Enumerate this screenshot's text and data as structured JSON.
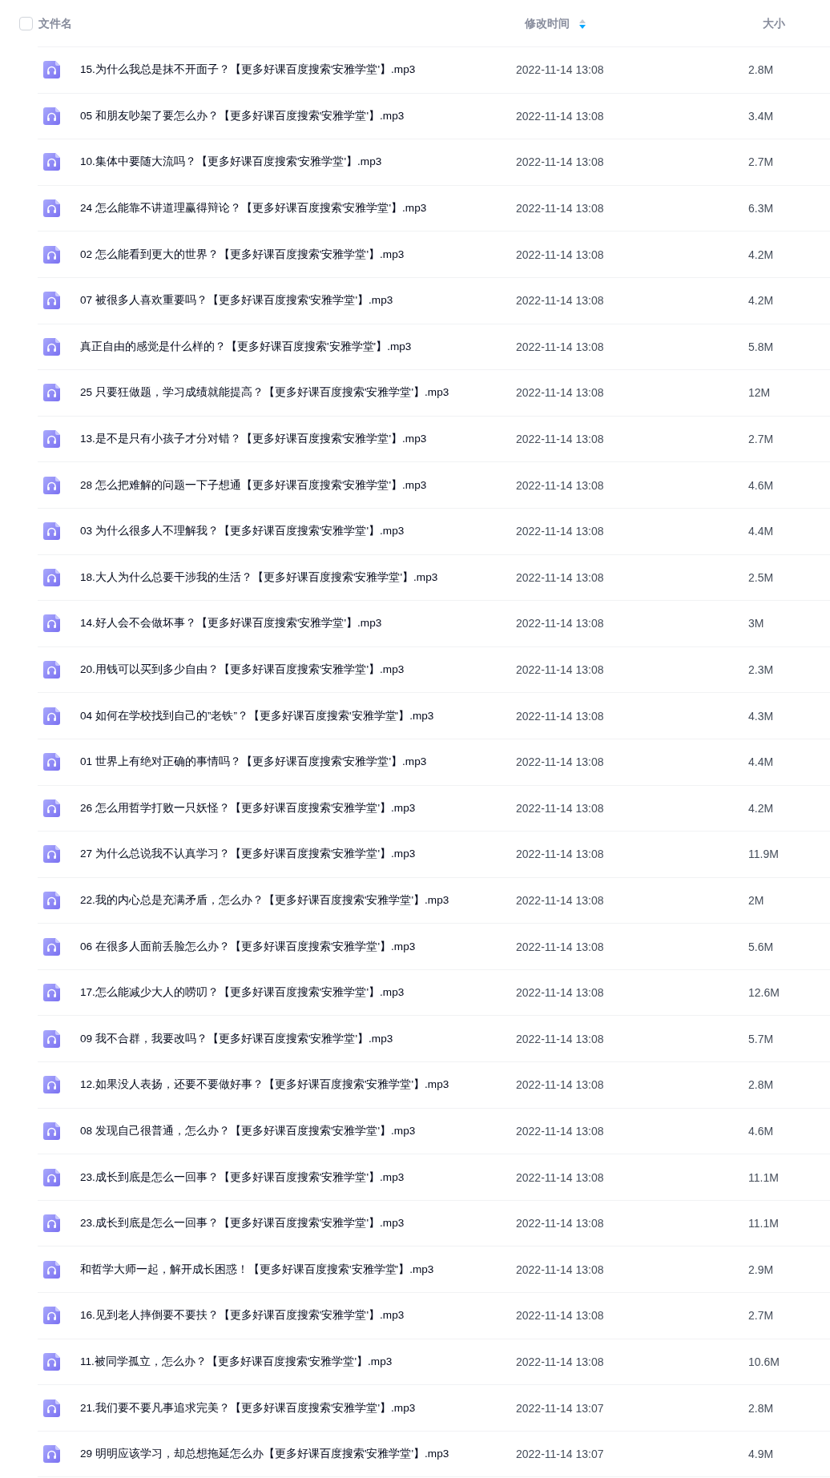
{
  "header": {
    "select_all": {
      "checked": false
    },
    "columns": [
      {
        "label": "文件名"
      },
      {
        "label": "修改时间",
        "sort_descending": true
      },
      {
        "label": "大小"
      }
    ]
  },
  "files": [
    {
      "name": "15.为什么我总是抹不开面子？【更多好课百度搜索'安雅学堂'】.mp3",
      "modified": "2022-11-14 13:08",
      "size": "2.8M"
    },
    {
      "name": "05 和朋友吵架了要怎么办？【更多好课百度搜索'安雅学堂'】.mp3",
      "modified": "2022-11-14 13:08",
      "size": "3.4M"
    },
    {
      "name": "10.集体中要随大流吗？【更多好课百度搜索'安雅学堂'】.mp3",
      "modified": "2022-11-14 13:08",
      "size": "2.7M"
    },
    {
      "name": "24 怎么能靠不讲道理赢得辩论？【更多好课百度搜索'安雅学堂'】.mp3",
      "modified": "2022-11-14 13:08",
      "size": "6.3M"
    },
    {
      "name": "02 怎么能看到更大的世界？【更多好课百度搜索'安雅学堂'】.mp3",
      "modified": "2022-11-14 13:08",
      "size": "4.2M"
    },
    {
      "name": "07 被很多人喜欢重要吗？【更多好课百度搜索'安雅学堂'】.mp3",
      "modified": "2022-11-14 13:08",
      "size": "4.2M"
    },
    {
      "name": "真正自由的感觉是什么样的？【更多好课百度搜索'安雅学堂'】.mp3",
      "modified": "2022-11-14 13:08",
      "size": "5.8M"
    },
    {
      "name": "25 只要狂做题，学习成绩就能提高？【更多好课百度搜索'安雅学堂'】.mp3",
      "modified": "2022-11-14 13:08",
      "size": "12M"
    },
    {
      "name": "13.是不是只有小孩子才分对错？【更多好课百度搜索'安雅学堂'】.mp3",
      "modified": "2022-11-14 13:08",
      "size": "2.7M"
    },
    {
      "name": "28 怎么把难解的问题一下子想通【更多好课百度搜索'安雅学堂'】.mp3",
      "modified": "2022-11-14 13:08",
      "size": "4.6M"
    },
    {
      "name": "03 为什么很多人不理解我？【更多好课百度搜索'安雅学堂'】.mp3",
      "modified": "2022-11-14 13:08",
      "size": "4.4M"
    },
    {
      "name": "18.大人为什么总要干涉我的生活？【更多好课百度搜索'安雅学堂'】.mp3",
      "modified": "2022-11-14 13:08",
      "size": "2.5M"
    },
    {
      "name": "14.好人会不会做坏事？【更多好课百度搜索'安雅学堂'】.mp3",
      "modified": "2022-11-14 13:08",
      "size": "3M"
    },
    {
      "name": "20.用钱可以买到多少自由？【更多好课百度搜索'安雅学堂'】.mp3",
      "modified": "2022-11-14 13:08",
      "size": "2.3M"
    },
    {
      "name": "04 如何在学校找到自己的”老铁”？【更多好课百度搜索'安雅学堂'】.mp3",
      "modified": "2022-11-14 13:08",
      "size": "4.3M"
    },
    {
      "name": "01 世界上有绝对正确的事情吗？【更多好课百度搜索'安雅学堂'】.mp3",
      "modified": "2022-11-14 13:08",
      "size": "4.4M"
    },
    {
      "name": "26 怎么用哲学打败一只妖怪？【更多好课百度搜索'安雅学堂'】.mp3",
      "modified": "2022-11-14 13:08",
      "size": "4.2M"
    },
    {
      "name": "27 为什么总说我不认真学习？【更多好课百度搜索'安雅学堂'】.mp3",
      "modified": "2022-11-14 13:08",
      "size": "11.9M"
    },
    {
      "name": "22.我的内心总是充满矛盾，怎么办？【更多好课百度搜索'安雅学堂'】.mp3",
      "modified": "2022-11-14 13:08",
      "size": "2M"
    },
    {
      "name": "06 在很多人面前丢脸怎么办？【更多好课百度搜索'安雅学堂'】.mp3",
      "modified": "2022-11-14 13:08",
      "size": "5.6M"
    },
    {
      "name": "17.怎么能减少大人的唠叨？【更多好课百度搜索'安雅学堂'】.mp3",
      "modified": "2022-11-14 13:08",
      "size": "12.6M"
    },
    {
      "name": "09 我不合群，我要改吗？【更多好课百度搜索'安雅学堂'】.mp3",
      "modified": "2022-11-14 13:08",
      "size": "5.7M"
    },
    {
      "name": "12.如果没人表扬，还要不要做好事？【更多好课百度搜索'安雅学堂'】.mp3",
      "modified": "2022-11-14 13:08",
      "size": "2.8M"
    },
    {
      "name": "08 发现自己很普通，怎么办？【更多好课百度搜索'安雅学堂'】.mp3",
      "modified": "2022-11-14 13:08",
      "size": "4.6M"
    },
    {
      "name": "23.成长到底是怎么一回事？【更多好课百度搜索'安雅学堂'】.mp3",
      "modified": "2022-11-14 13:08",
      "size": "11.1M"
    },
    {
      "name": "23.成长到底是怎么一回事？【更多好课百度搜索'安雅学堂'】.mp3",
      "modified": "2022-11-14 13:08",
      "size": "11.1M"
    },
    {
      "name": "和哲学大师一起，解开成长困惑！【更多好课百度搜索'安雅学堂'】.mp3",
      "modified": "2022-11-14 13:08",
      "size": "2.9M"
    },
    {
      "name": "16.见到老人摔倒要不要扶？【更多好课百度搜索'安雅学堂'】.mp3",
      "modified": "2022-11-14 13:08",
      "size": "2.7M"
    },
    {
      "name": "11.被同学孤立，怎么办？【更多好课百度搜索'安雅学堂'】.mp3",
      "modified": "2022-11-14 13:08",
      "size": "10.6M"
    },
    {
      "name": "21.我们要不要凡事追求完美？【更多好课百度搜索'安雅学堂'】.mp3",
      "modified": "2022-11-14 13:07",
      "size": "2.8M"
    },
    {
      "name": "29 明明应该学习，却总想拖延怎么办【更多好课百度搜索'安雅学堂'】.mp3",
      "modified": "2022-11-14 13:07",
      "size": "4.9M"
    }
  ]
}
